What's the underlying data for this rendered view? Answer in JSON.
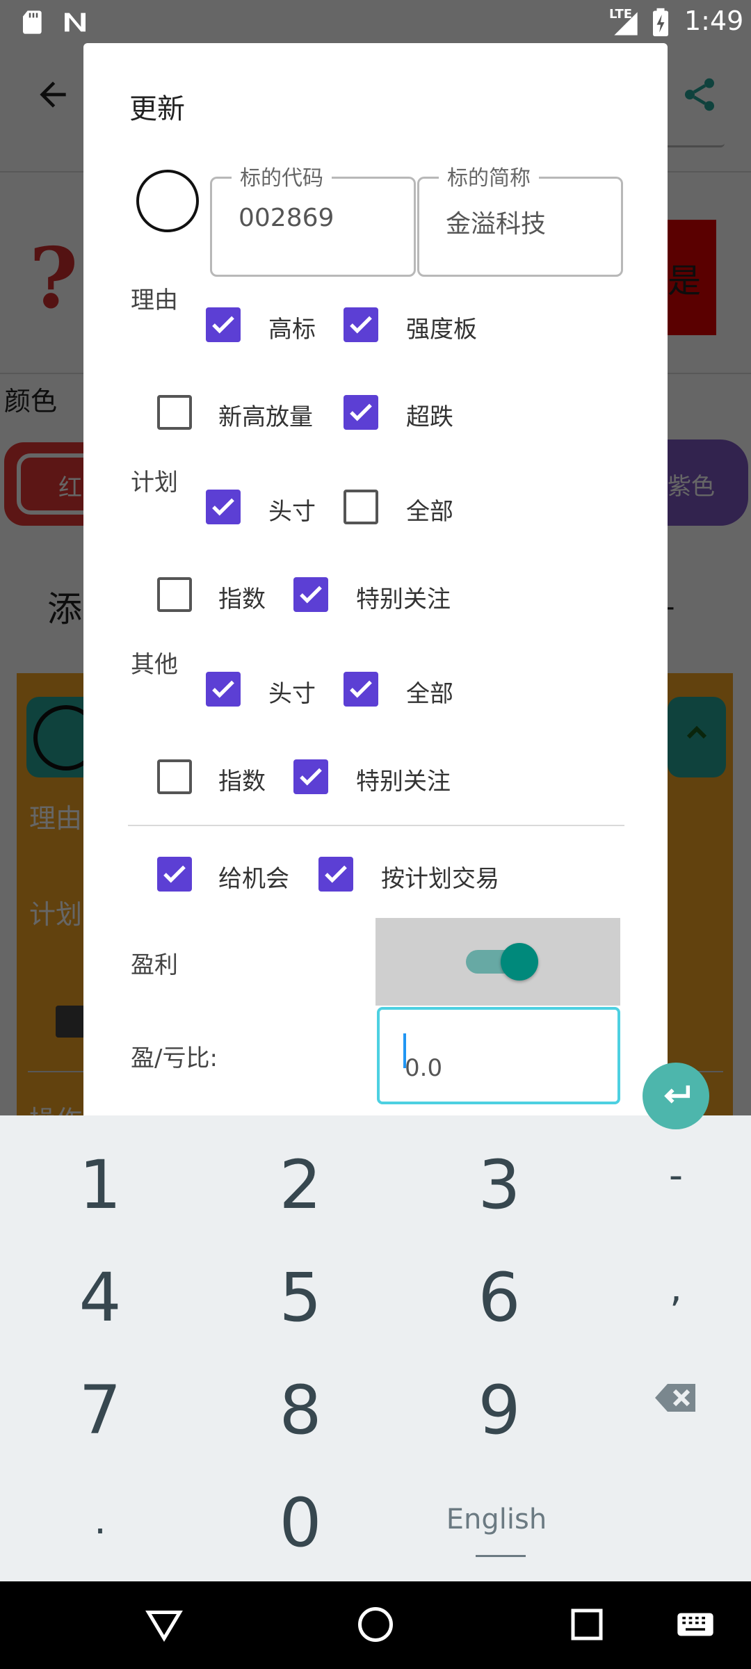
{
  "status_bar": {
    "time": "1:49",
    "network": "LTE",
    "icons": [
      "sd-card-icon",
      "n-app-icon",
      "signal-icon",
      "battery-charging-icon"
    ]
  },
  "background": {
    "question_mark": "?",
    "red_button_partial": "是",
    "color_label": "颜色",
    "chip_red_partial": "红",
    "chip_purple_partial": "紫色",
    "add_partial": "添",
    "dash": "-",
    "reason_label": "理由",
    "plan_label": "计划",
    "op_partial": "操作"
  },
  "dialog": {
    "title": "更新",
    "code_field": {
      "label": "标的代码",
      "value": "002869"
    },
    "name_field": {
      "label": "标的简称",
      "value": "金溢科技"
    },
    "reason": {
      "label": "理由",
      "options": [
        {
          "label": "高标",
          "checked": true
        },
        {
          "label": "强度板",
          "checked": true
        },
        {
          "label": "新高放量",
          "checked": false
        },
        {
          "label": "超跌",
          "checked": true
        }
      ]
    },
    "plan": {
      "label": "计划",
      "options": [
        {
          "label": "头寸",
          "checked": true
        },
        {
          "label": "全部",
          "checked": false
        },
        {
          "label": "指数",
          "checked": false
        },
        {
          "label": "特别关注",
          "checked": true
        }
      ]
    },
    "other": {
      "label": "其他",
      "options": [
        {
          "label": "头寸",
          "checked": true
        },
        {
          "label": "全部",
          "checked": true
        },
        {
          "label": "指数",
          "checked": false
        },
        {
          "label": "特别关注",
          "checked": true
        }
      ]
    },
    "execution": {
      "options": [
        {
          "label": "给机会",
          "checked": true
        },
        {
          "label": "按计划交易",
          "checked": true
        }
      ]
    },
    "profit": {
      "label": "盈利",
      "switch_on": true
    },
    "ratio": {
      "label": "盈/亏比:",
      "value": "0.0"
    }
  },
  "keyboard": {
    "rows": [
      [
        "1",
        "2",
        "3",
        "-"
      ],
      [
        "4",
        "5",
        "6",
        ","
      ],
      [
        "7",
        "8",
        "9",
        "backspace"
      ],
      [
        ".",
        "0",
        "English",
        "enter"
      ]
    ],
    "language": "English"
  },
  "colors": {
    "checkbox": "#5c3fd4",
    "switch_thumb": "#00897b",
    "input_focus": "#4dd0e1",
    "keyboard_bg": "#eceff1",
    "enter_key": "#4db6ac"
  }
}
